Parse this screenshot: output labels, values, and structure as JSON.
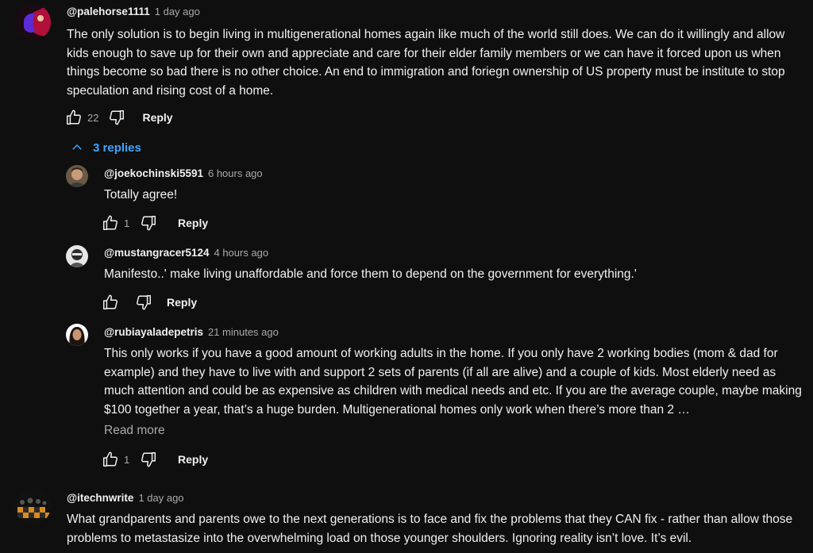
{
  "colors": {
    "background": "#0f0f0f",
    "text_primary": "#f1f1f1",
    "text_secondary": "#aaaaaa",
    "link_blue": "#3ea6ff"
  },
  "comments": [
    {
      "author": "@palehorse1111",
      "time": "1 day ago",
      "text": "The only solution is to begin living in multigenerational homes again like much of the world still does.  We can do it willingly and allow kids enough to save up for their own and appreciate and care for their elder family members or we can have it forced upon us when things become so bad there is no other choice.  An end to immigration and foriegn  ownership of US property must be institute to stop speculation and rising cost of a home.",
      "likes": "22",
      "reply_label": "Reply",
      "icons": {
        "like": "thumb-up-icon",
        "dislike": "thumb-down-icon"
      }
    },
    {
      "author": "@itechnwrite",
      "time": "1 day ago",
      "text": "What grandparents and parents owe to the next generations is to face and fix the problems that they CAN fix - rather than allow those problems to metastasize into the overwhelming load on those younger shoulders. Ignoring reality isn’t love. It’s evil."
    }
  ],
  "replies_toggle": {
    "label": "3 replies",
    "icon": "chevron-up-icon"
  },
  "replies": [
    {
      "author": "@joekochinski5591",
      "time": "6 hours ago",
      "text": "Totally agree!",
      "likes": "1",
      "reply_label": "Reply"
    },
    {
      "author": "@mustangracer5124",
      "time": "4 hours ago",
      "text": "Manifesto..' make living unaffordable and force them to depend on the government for everything.'",
      "likes": "",
      "reply_label": "Reply"
    },
    {
      "author": "@rubiayaladepetris",
      "time": "21 minutes ago",
      "text": "This only works if you have a good amount of working adults in the home. If you only have 2 working bodies (mom & dad for example) and they have to live with and support 2 sets of parents (if all are alive) and a couple of kids. Most elderly need as much attention and could be as expensive as children with medical needs and etc. If you are the average couple, maybe making $100 together a year, that’s a huge burden. Multigenerational homes only work when there’s more than 2 …",
      "read_more": "Read more",
      "likes": "1",
      "reply_label": "Reply"
    }
  ]
}
